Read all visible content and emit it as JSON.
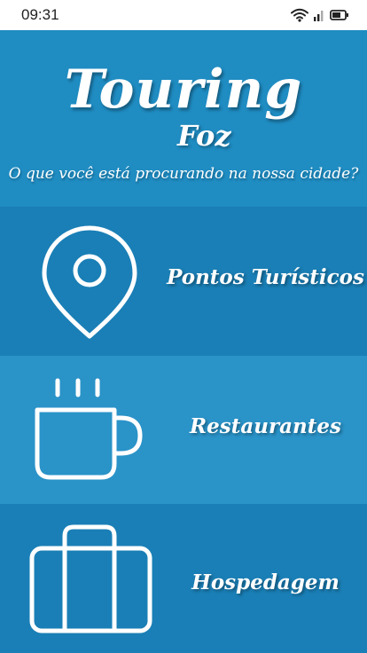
{
  "status_bar": {
    "time": "09:31",
    "icons": [
      "wifi-icon",
      "signal-icon",
      "battery-icon"
    ]
  },
  "header": {
    "title": "Touring",
    "subtitle": "Foz",
    "question": "O que você está procurando na nossa cidade?"
  },
  "menu": {
    "items": [
      {
        "label": "Pontos Turísticos",
        "icon": "location-pin-icon"
      },
      {
        "label": "Restaurantes",
        "icon": "coffee-cup-icon"
      },
      {
        "label": "Hospedagem",
        "icon": "suitcase-icon"
      }
    ]
  },
  "colors": {
    "background": "#1b8bc3",
    "row_dark": "#1a7fb6",
    "row_light": "#2a93c8",
    "text": "#ffffff"
  }
}
